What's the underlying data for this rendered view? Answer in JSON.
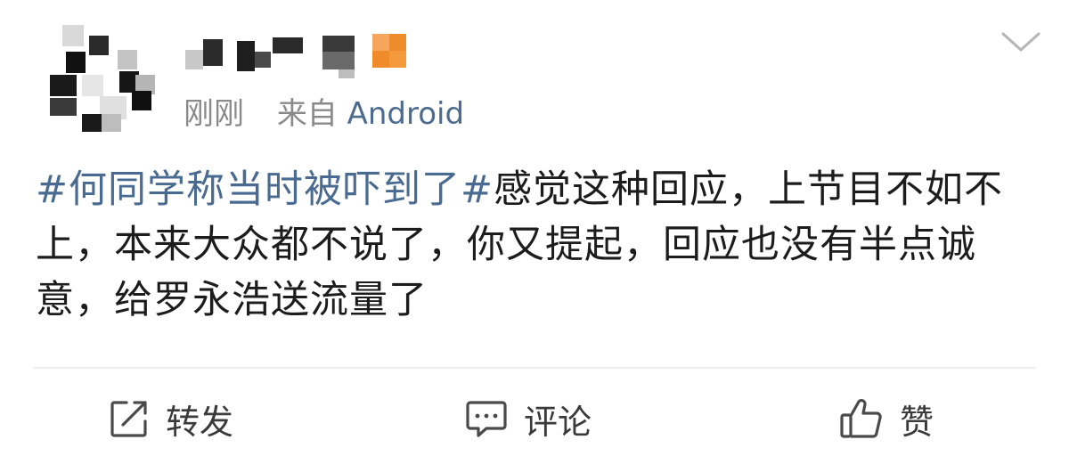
{
  "post": {
    "author": {
      "avatar_icon": "pixelated-avatar",
      "name_display": "pixelated-username",
      "badge_icon": "orange-vip-badge",
      "badge_color": "#f0962a"
    },
    "meta": {
      "time": "刚刚",
      "source": "来自",
      "source_link": "Android"
    },
    "menu_icon": "chevron-down-icon",
    "content": {
      "topic": "#何同学称当时被吓到了#",
      "text": "感觉这种回应，上节目不如不上，本来大众都不说了，你又提起，回应也没有半点诚意，给罗永浩送流量了"
    }
  },
  "actions": {
    "repost": {
      "icon": "share-icon",
      "label": "转发"
    },
    "comment": {
      "icon": "comment-icon",
      "label": "评论"
    },
    "like": {
      "icon": "thumbs-up-icon",
      "label": "赞"
    }
  },
  "colors": {
    "topic": "#4a6b91",
    "meta": "#8a8a8a",
    "source": "#4d6b8f",
    "divider": "#eeeeee"
  }
}
